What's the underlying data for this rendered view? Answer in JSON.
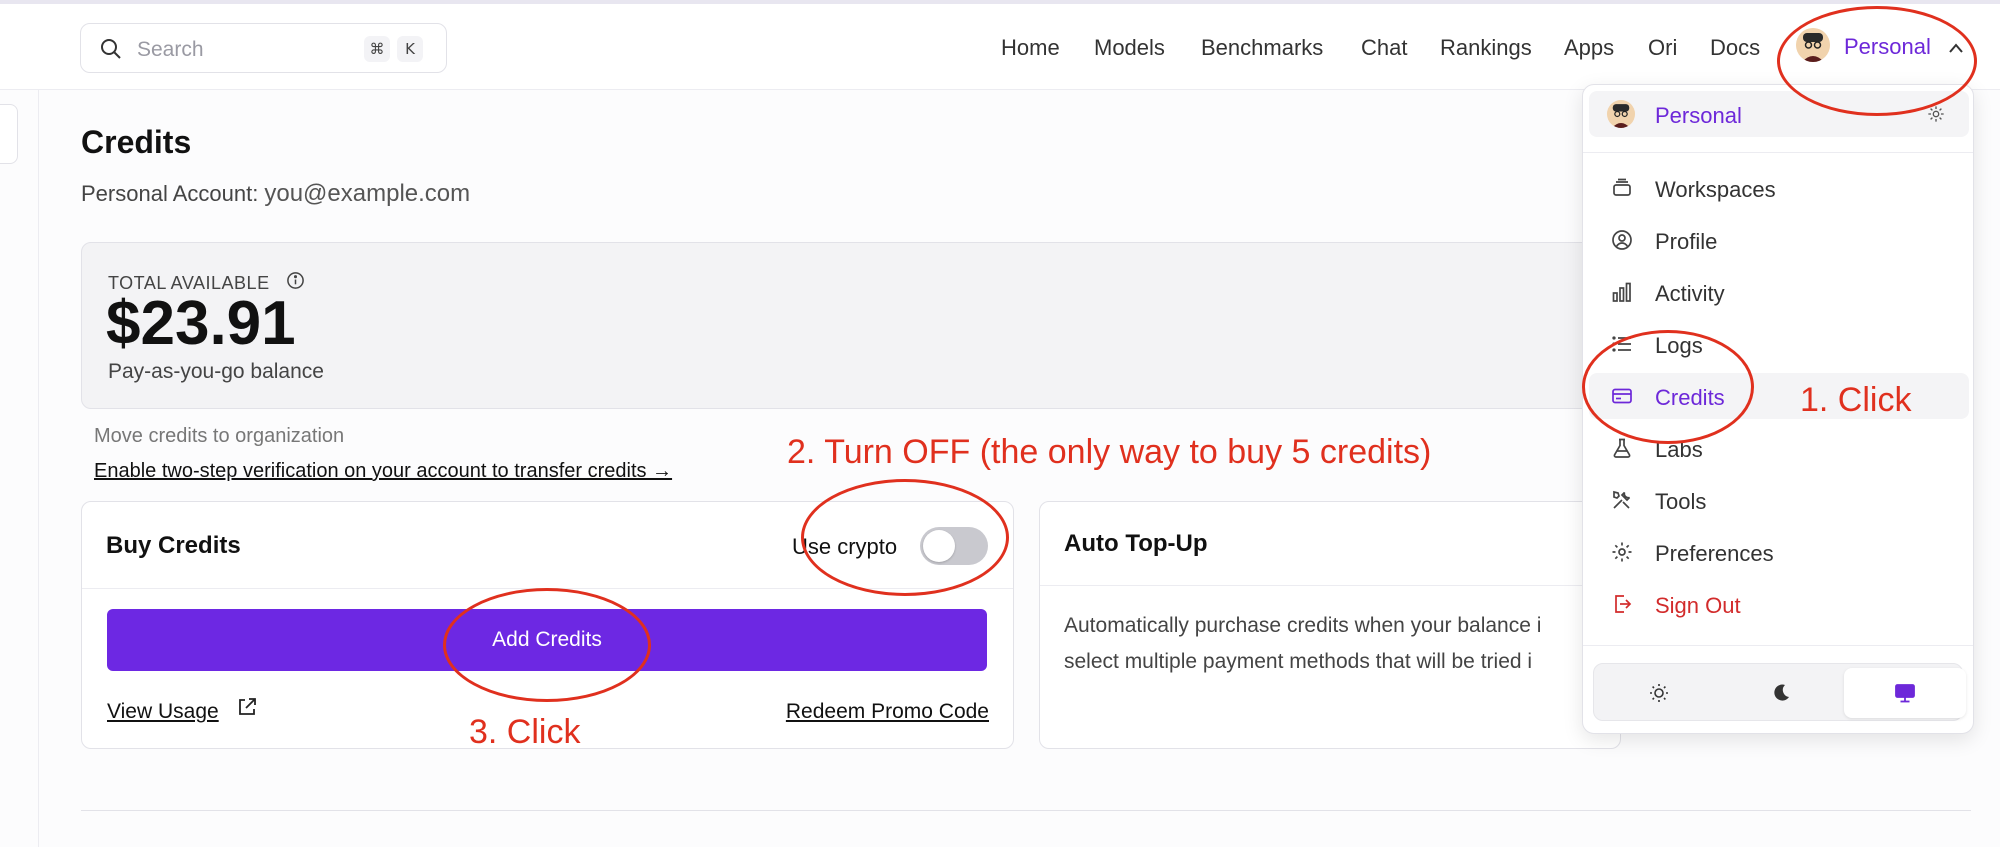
{
  "search": {
    "placeholder": "Search",
    "key1": "⌘",
    "key2": "K"
  },
  "nav": [
    "Home",
    "Models",
    "Benchmarks",
    "Chat",
    "Rankings",
    "Apps",
    "Ori",
    "Docs"
  ],
  "workspace": {
    "label": "Personal"
  },
  "page": {
    "title": "Credits",
    "account_label": "Personal Account:",
    "account_email": "you@example.com"
  },
  "balance": {
    "label": "TOTAL AVAILABLE",
    "amount": "$23.91",
    "sub": "Pay-as-you-go balance"
  },
  "move": {
    "label": "Move credits to organization",
    "link": "Enable two-step verification on your account to transfer credits →"
  },
  "buy": {
    "title": "Buy Credits",
    "crypto_label": "Use crypto",
    "crypto_enabled": false,
    "add_button": "Add Credits",
    "view_usage": "View Usage",
    "redeem": "Redeem Promo Code"
  },
  "autotopup": {
    "title": "Auto Top-Up",
    "desc_line1": "Automatically purchase credits when your balance i",
    "desc_line2": "select multiple payment methods that will be tried i"
  },
  "menu": {
    "header": "Personal",
    "items": [
      {
        "label": "Workspaces",
        "icon": "workspaces-icon"
      },
      {
        "label": "Profile",
        "icon": "profile-icon"
      },
      {
        "label": "Activity",
        "icon": "activity-icon"
      },
      {
        "label": "Logs",
        "icon": "logs-icon"
      },
      {
        "label": "Credits",
        "icon": "credits-icon"
      },
      {
        "label": "Labs",
        "icon": "labs-icon"
      },
      {
        "label": "Tools",
        "icon": "tools-icon"
      },
      {
        "label": "Preferences",
        "icon": "preferences-icon"
      },
      {
        "label": "Sign Out",
        "icon": "sign-out-icon"
      }
    ],
    "theme": [
      "light",
      "dark",
      "system"
    ],
    "theme_selected": "system"
  },
  "annotations": {
    "step1": "1. Click",
    "step2": "2. Turn OFF (the only way to buy 5 credits)",
    "step3": "3. Click"
  },
  "colors": {
    "accent": "#6d28e3",
    "annotation": "#e0301e",
    "danger": "#d22b2b"
  }
}
